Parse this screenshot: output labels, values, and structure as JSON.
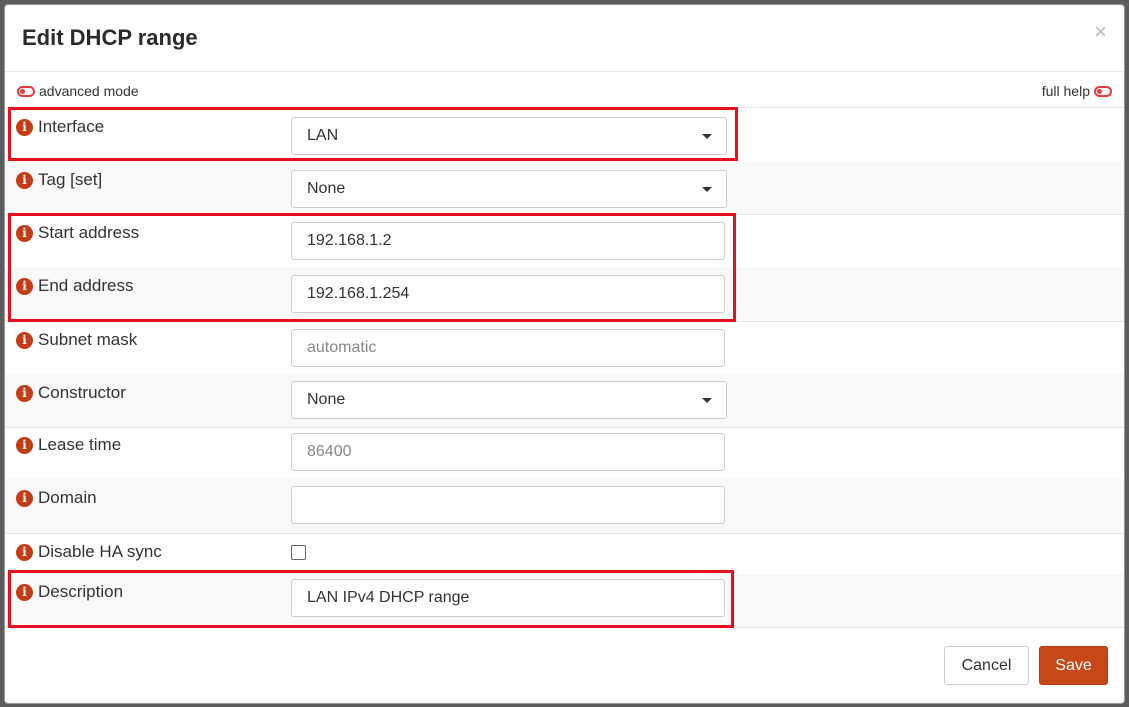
{
  "dialog": {
    "title": "Edit DHCP range",
    "close_glyph": "×"
  },
  "toggles": {
    "advanced_label": "advanced mode",
    "full_help_label": "full help"
  },
  "info_glyph": "i",
  "fields": {
    "interface": {
      "label": "Interface",
      "value": "LAN"
    },
    "tag": {
      "label": "Tag [set]",
      "value": "None"
    },
    "start_address": {
      "label": "Start address",
      "value": "192.168.1.2"
    },
    "end_address": {
      "label": "End address",
      "value": "192.168.1.254"
    },
    "subnet_mask": {
      "label": "Subnet mask",
      "placeholder": "automatic"
    },
    "constructor": {
      "label": "Constructor",
      "value": "None"
    },
    "lease_time": {
      "label": "Lease time",
      "placeholder": "86400"
    },
    "domain": {
      "label": "Domain",
      "value": ""
    },
    "disable_ha_sync": {
      "label": "Disable HA sync",
      "checked": false
    },
    "description": {
      "label": "Description",
      "value": "LAN IPv4 DHCP range"
    }
  },
  "buttons": {
    "cancel": "Cancel",
    "save": "Save"
  },
  "colors": {
    "accent": "#c84716",
    "info_icon": "#c43c16",
    "highlight": "#e8101e",
    "toggle": "#e63b3b"
  }
}
